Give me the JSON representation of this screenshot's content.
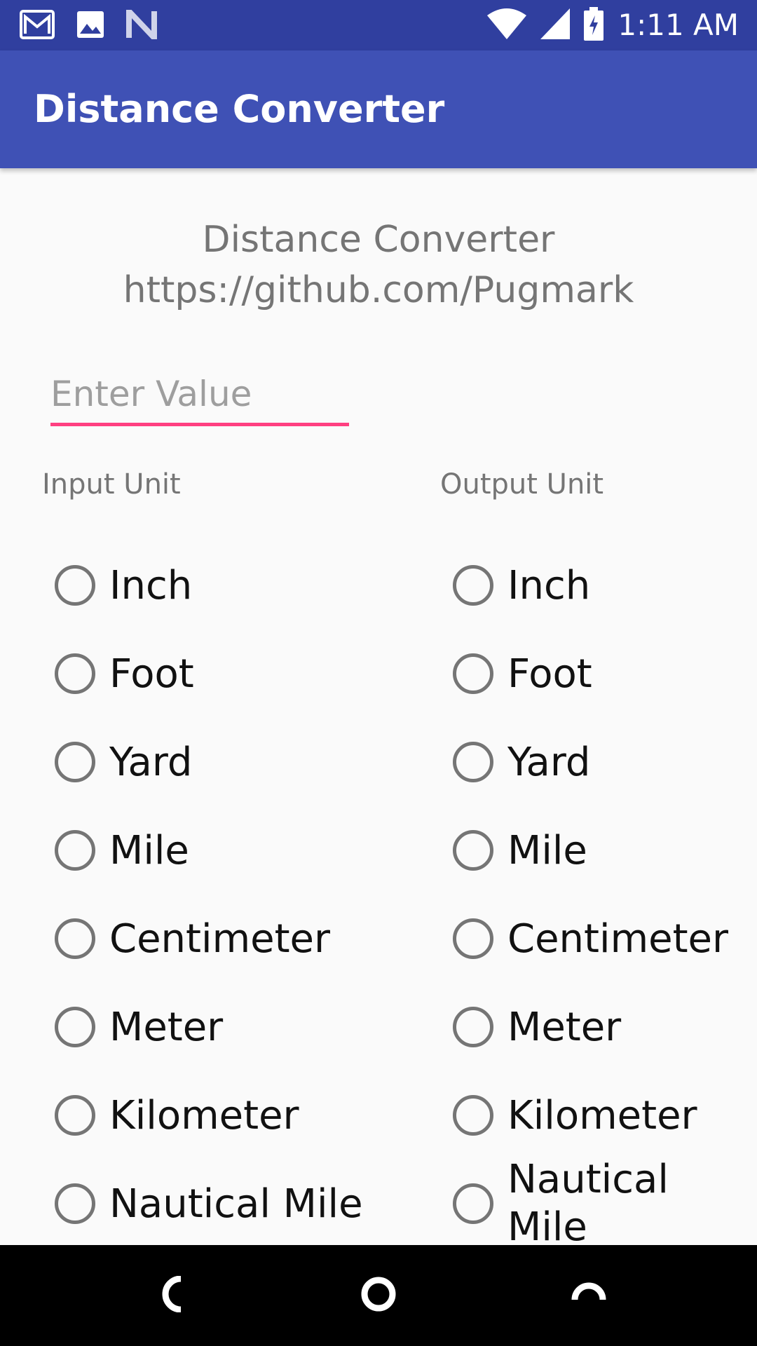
{
  "colors": {
    "status_bar": "#303f9f",
    "app_bar": "#3f51b5",
    "accent": "#ff4081",
    "nav_bar": "#000000"
  },
  "status_bar": {
    "time": "1:11 AM",
    "left_icons": [
      "gmail-icon",
      "image-icon",
      "notification-n-icon"
    ],
    "right_icons": [
      "wifi-icon",
      "cell-signal-icon",
      "battery-charging-icon"
    ]
  },
  "app_bar": {
    "title": "Distance Converter"
  },
  "header": {
    "line1": "Distance Converter",
    "line2": "https://github.com/Pugmark"
  },
  "value_input": {
    "value": "",
    "placeholder": "Enter Value"
  },
  "input_unit": {
    "label": "Input Unit",
    "options": [
      "Inch",
      "Foot",
      "Yard",
      "Mile",
      "Centimeter",
      "Meter",
      "Kilometer",
      "Nautical Mile"
    ]
  },
  "output_unit": {
    "label": "Output Unit",
    "options": [
      "Inch",
      "Foot",
      "Yard",
      "Mile",
      "Centimeter",
      "Meter",
      "Kilometer",
      "Nautical Mile"
    ]
  },
  "nav": {
    "icons": [
      "back-icon",
      "home-icon",
      "recents-icon"
    ]
  }
}
